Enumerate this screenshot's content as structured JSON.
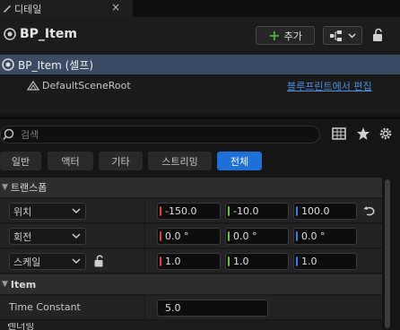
{
  "tab": {
    "title": "디테일",
    "close": "×"
  },
  "header": {
    "blueprint_name": "BP_Item",
    "add_label": "추가"
  },
  "tree": {
    "root_label": "BP_Item (셀프)",
    "scene_root_label": "DefaultSceneRoot",
    "edit_link": "블루프린트에서 편집"
  },
  "search": {
    "placeholder": "검색"
  },
  "filters": [
    "일반",
    "액터",
    "기타",
    "스트리밍",
    "전체"
  ],
  "active_filter": "전체",
  "sections": {
    "transform": "트랜스폼",
    "item": "Item"
  },
  "transform": {
    "location": {
      "label": "위치",
      "x": "-150.0",
      "y": "-10.0",
      "z": "100.0"
    },
    "rotation": {
      "label": "회전",
      "x": "0.0 °",
      "y": "0.0 °",
      "z": "0.0 °"
    },
    "scale": {
      "label": "스케일",
      "x": "1.0",
      "y": "1.0",
      "z": "1.0"
    }
  },
  "item": {
    "time_constant_label": "Time Constant",
    "time_constant_value": "5.0"
  },
  "next_section_peek": "렌더링",
  "colors": {
    "accent": "#1f6fd8",
    "axis_x": "#e0413a",
    "axis_y": "#6ec43a",
    "axis_z": "#3a7de0",
    "link": "#4a90e2",
    "selection": "#3a4c63"
  }
}
